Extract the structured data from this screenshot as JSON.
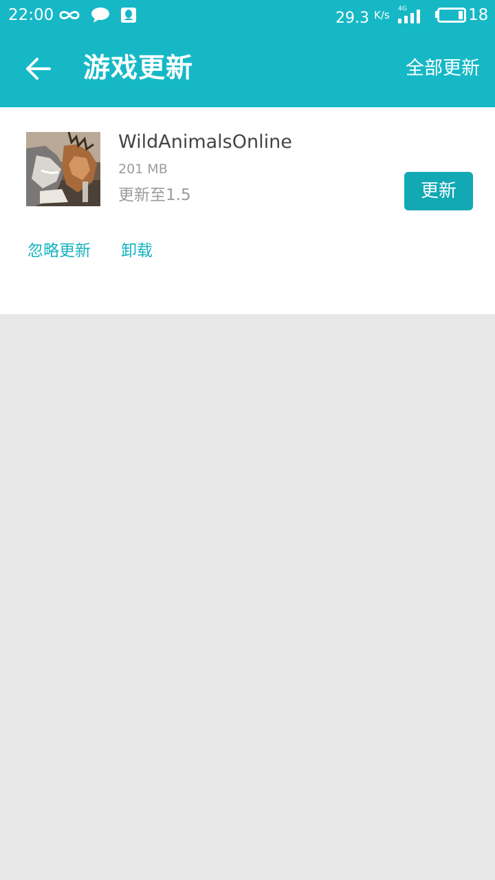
{
  "status_bar": {
    "time": "22:00",
    "speed": "29.3",
    "speed_unit": "K/s",
    "network": "4G",
    "battery": "18",
    "icons": [
      "infinity-icon",
      "message-bubble-icon",
      "qq-icon",
      "signal-icon",
      "battery-icon"
    ]
  },
  "header": {
    "title": "游戏更新",
    "update_all_label": "全部更新"
  },
  "update_item": {
    "name": "WildAnimalsOnline",
    "size": "201 MB",
    "version_text": "更新至1.5",
    "update_label": "更新",
    "ignore_label": "忽略更新",
    "uninstall_label": "卸载"
  },
  "colors": {
    "accent": "#16b8c6",
    "button": "#12a9b4",
    "link": "#16b3c0",
    "background": "#e8e8e8"
  }
}
